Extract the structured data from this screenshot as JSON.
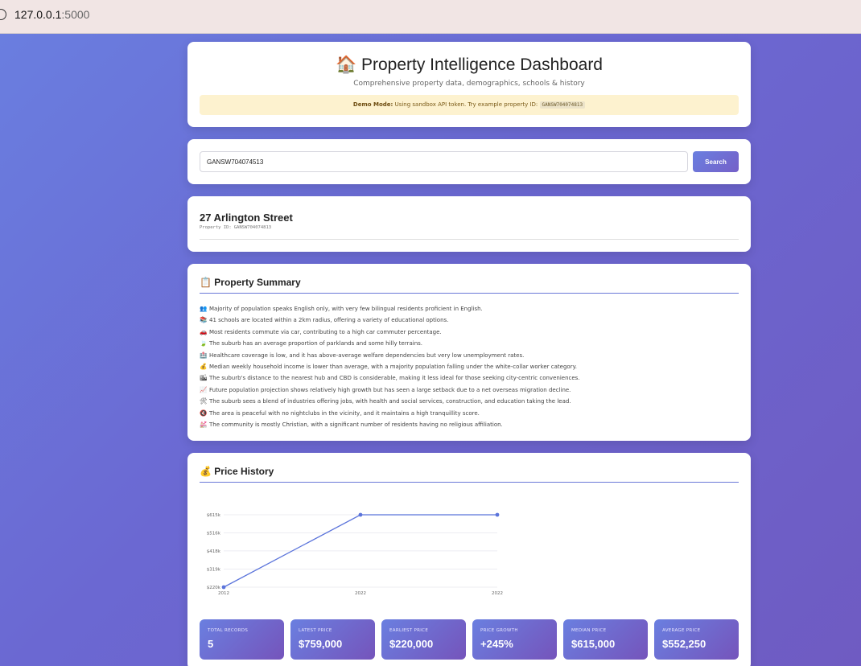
{
  "browser": {
    "url_host": "127.0.0.1",
    "url_port": ":5000"
  },
  "header": {
    "icon": "house-icon",
    "title": "🏠 Property Intelligence Dashboard",
    "subtitle": "Comprehensive property data, demographics, schools & history",
    "demo_label": "Demo Mode:",
    "demo_text": "Using sandbox API token. Try example property ID:",
    "demo_code": "GANSW704074813"
  },
  "search": {
    "value": "GANSW704074513",
    "button_label": "Search"
  },
  "property": {
    "address": "27 Arlington Street",
    "id_label": "Property ID:",
    "id_value": "GANSW704074813"
  },
  "summary": {
    "title": "📋 Property Summary",
    "items": [
      {
        "emoji": "👥",
        "icon": "people-icon",
        "text": "Majority of population speaks English only, with very few bilingual residents proficient in English."
      },
      {
        "emoji": "📚",
        "icon": "books-icon",
        "text": "41 schools are located within a 2km radius, offering a variety of educational options."
      },
      {
        "emoji": "🚗",
        "icon": "car-icon",
        "text": "Most residents commute via car, contributing to a high car commuter percentage."
      },
      {
        "emoji": "🍃",
        "icon": "leaf-icon",
        "text": "The suburb has an average proportion of parklands and some hilly terrains."
      },
      {
        "emoji": "🏥",
        "icon": "hospital-icon",
        "text": "Healthcare coverage is low, and it has above-average welfare dependencies but very low unemployment rates."
      },
      {
        "emoji": "💰",
        "icon": "money-bag-icon",
        "text": "Median weekly household income is lower than average, with a majority population falling under the white-collar worker category."
      },
      {
        "emoji": "🏙",
        "icon": "cityscape-icon",
        "text": "The suburb's distance to the nearest hub and CBD is considerable, making it less ideal for those seeking city-centric conveniences."
      },
      {
        "emoji": "📈",
        "icon": "chart-up-icon",
        "text": "Future population projection shows relatively high growth but has seen a large setback due to a net overseas migration decline."
      },
      {
        "emoji": "🛠",
        "icon": "tools-icon",
        "text": "The suburb sees a blend of industries offering jobs, with health and social services, construction, and education taking the lead."
      },
      {
        "emoji": "🔇",
        "icon": "muted-icon",
        "text": "The area is peaceful with no nightclubs in the vicinity, and it maintains a high tranquillity score."
      },
      {
        "emoji": "💒",
        "icon": "wedding-icon",
        "text": "The community is mostly Christian, with a significant number of residents having no religious affiliation."
      }
    ]
  },
  "price_history": {
    "title": "💰 Price History",
    "stats": [
      {
        "label": "TOTAL RECORDS",
        "value": "5"
      },
      {
        "label": "LATEST PRICE",
        "value": "$759,000"
      },
      {
        "label": "EARLIEST PRICE",
        "value": "$220,000"
      },
      {
        "label": "PRICE GROWTH",
        "value": "+245%"
      },
      {
        "label": "MEDIAN PRICE",
        "value": "$615,000"
      },
      {
        "label": "AVERAGE PRICE",
        "value": "$552,250"
      }
    ]
  },
  "chart_data": {
    "type": "line",
    "title": "",
    "xlabel": "",
    "ylabel": "",
    "categories": [
      "2012",
      "2022",
      "2022"
    ],
    "values": [
      220000,
      615000,
      615000
    ],
    "ytick_labels": [
      "$220k",
      "$319k",
      "$418k",
      "$516k",
      "$615k"
    ],
    "ytick_values": [
      220000,
      319000,
      418000,
      516000,
      615000
    ],
    "ylim": [
      220000,
      615000
    ],
    "grid": true,
    "line_color": "#5b74db"
  }
}
